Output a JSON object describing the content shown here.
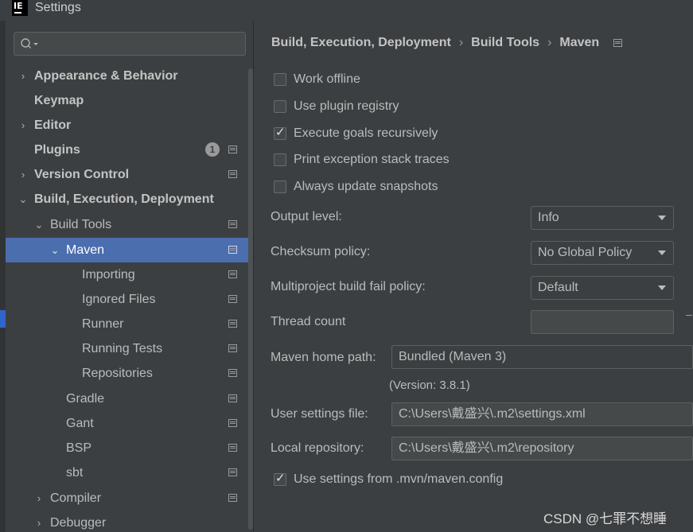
{
  "window": {
    "title": "Settings",
    "logo_text": "IE"
  },
  "search": {
    "placeholder": ""
  },
  "sidebar": {
    "items": [
      {
        "label": "Appearance & Behavior",
        "arrow": "›",
        "bold": true
      },
      {
        "label": "Keymap",
        "arrow": "",
        "bold": true
      },
      {
        "label": "Editor",
        "arrow": "›",
        "bold": true
      },
      {
        "label": "Plugins",
        "arrow": "",
        "bold": true,
        "badge": "1"
      },
      {
        "label": "Version Control",
        "arrow": "›",
        "bold": true
      },
      {
        "label": "Build, Execution, Deployment",
        "arrow": "⌄",
        "bold": true
      },
      {
        "label": "Build Tools",
        "arrow": "⌄",
        "bold": false
      },
      {
        "label": "Maven",
        "arrow": "⌄",
        "bold": false,
        "selected": true
      },
      {
        "label": "Importing",
        "arrow": "",
        "bold": false
      },
      {
        "label": "Ignored Files",
        "arrow": "",
        "bold": false
      },
      {
        "label": "Runner",
        "arrow": "",
        "bold": false
      },
      {
        "label": "Running Tests",
        "arrow": "",
        "bold": false
      },
      {
        "label": "Repositories",
        "arrow": "",
        "bold": false
      },
      {
        "label": "Gradle",
        "arrow": "",
        "bold": false
      },
      {
        "label": "Gant",
        "arrow": "",
        "bold": false
      },
      {
        "label": "BSP",
        "arrow": "",
        "bold": false
      },
      {
        "label": "sbt",
        "arrow": "",
        "bold": false
      },
      {
        "label": "Compiler",
        "arrow": "›",
        "bold": false
      },
      {
        "label": "Debugger",
        "arrow": "›",
        "bold": false
      }
    ]
  },
  "breadcrumb": {
    "parts": [
      "Build, Execution, Deployment",
      "Build Tools",
      "Maven"
    ],
    "separator": "›"
  },
  "options": {
    "work_offline": {
      "label": "Work offline",
      "checked": false
    },
    "use_plugin_registry": {
      "label": "Use plugin registry",
      "checked": false
    },
    "execute_goals_recursively": {
      "label": "Execute goals recursively",
      "checked": true
    },
    "print_exception_stack_traces": {
      "label": "Print exception stack traces",
      "checked": false
    },
    "always_update_snapshots": {
      "label": "Always update snapshots",
      "checked": false
    }
  },
  "fields": {
    "output_level": {
      "label": "Output level:",
      "value": "Info"
    },
    "checksum_policy": {
      "label": "Checksum policy:",
      "value": "No Global Policy"
    },
    "multiproject_fail_policy": {
      "label": "Multiproject build fail policy:",
      "value": "Default"
    },
    "thread_count": {
      "label": "Thread count",
      "value": ""
    },
    "maven_home": {
      "label": "Maven home path:",
      "value": "Bundled (Maven 3)"
    },
    "version": "(Version: 3.8.1)",
    "user_settings": {
      "label": "User settings file:",
      "value": "C:\\Users\\戴盛兴\\.m2\\settings.xml"
    },
    "local_repo": {
      "label": "Local repository:",
      "value": "C:\\Users\\戴盛兴\\.m2\\repository"
    },
    "use_mvn_config": {
      "label": "Use settings from .mvn/maven.config",
      "checked": true
    }
  },
  "check_glyph": "✓",
  "watermark": "CSDN @七罪不想睡"
}
